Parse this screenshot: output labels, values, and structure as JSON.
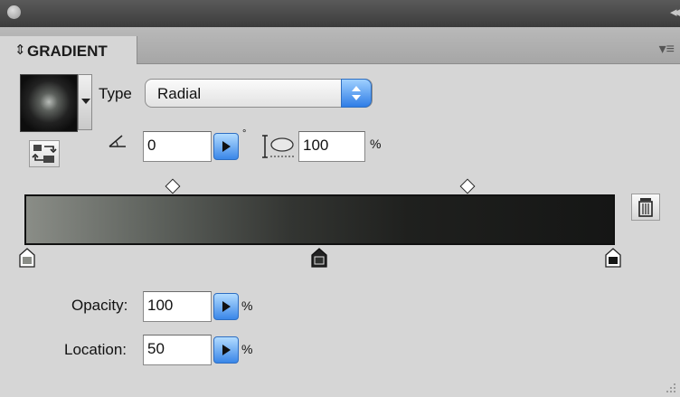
{
  "panel": {
    "tab_title": "GRADIENT"
  },
  "gradient": {
    "type_label": "Type",
    "type_value": "Radial",
    "angle_value": "0",
    "angle_unit": "°",
    "aspect_value": "100",
    "aspect_unit": "%"
  },
  "stop": {
    "opacity_label": "Opacity:",
    "opacity_value": "100",
    "opacity_unit": "%",
    "location_label": "Location:",
    "location_value": "50",
    "location_unit": "%"
  },
  "icons": {
    "panel_close": "close-circle-icon",
    "panel_collapse": "double-chevron-right-icon",
    "panel_menu": "panel-menu-icon",
    "reverse": "reverse-gradient-icon",
    "angle": "angle-icon",
    "aspect": "aspect-ratio-icon",
    "delete": "trash-icon"
  },
  "colors": {
    "panel_bg": "#d6d6d6",
    "accent_blue": "#3a86e8",
    "gradient_start": "#8a8d87",
    "gradient_end": "#151615"
  }
}
